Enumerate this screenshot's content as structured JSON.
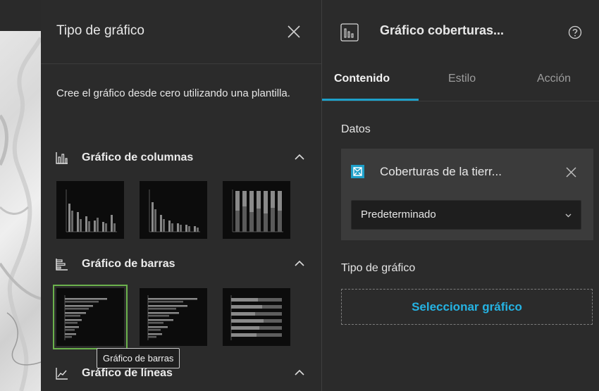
{
  "left_panel": {
    "title": "Tipo de gráfico",
    "description": "Cree el gráfico desde cero utilizando una plantilla.",
    "sections": [
      {
        "label": "Gráfico de columnas",
        "icon": "column-chart-icon"
      },
      {
        "label": "Gráfico de barras",
        "icon": "bar-chart-icon"
      },
      {
        "label": "Gráfico de líneas",
        "icon": "line-chart-icon"
      }
    ],
    "tooltip": "Gráfico de barras"
  },
  "right_panel": {
    "title": "Gráfico coberturas...",
    "tabs": [
      "Contenido",
      "Estilo",
      "Acción"
    ],
    "active_tab": "Contenido",
    "data_section": {
      "title": "Datos",
      "source_name": "Coberturas de la tierr...",
      "view_option": "Predeterminado"
    },
    "chart_type_section": {
      "title": "Tipo de gráfico",
      "button_label": "Seleccionar gráfico"
    }
  },
  "colors": {
    "panel_bg": "#2b2b2b",
    "accent_blue": "#1ea0c9",
    "link_blue": "#25b3e3",
    "selection_green": "#6bb24c"
  }
}
